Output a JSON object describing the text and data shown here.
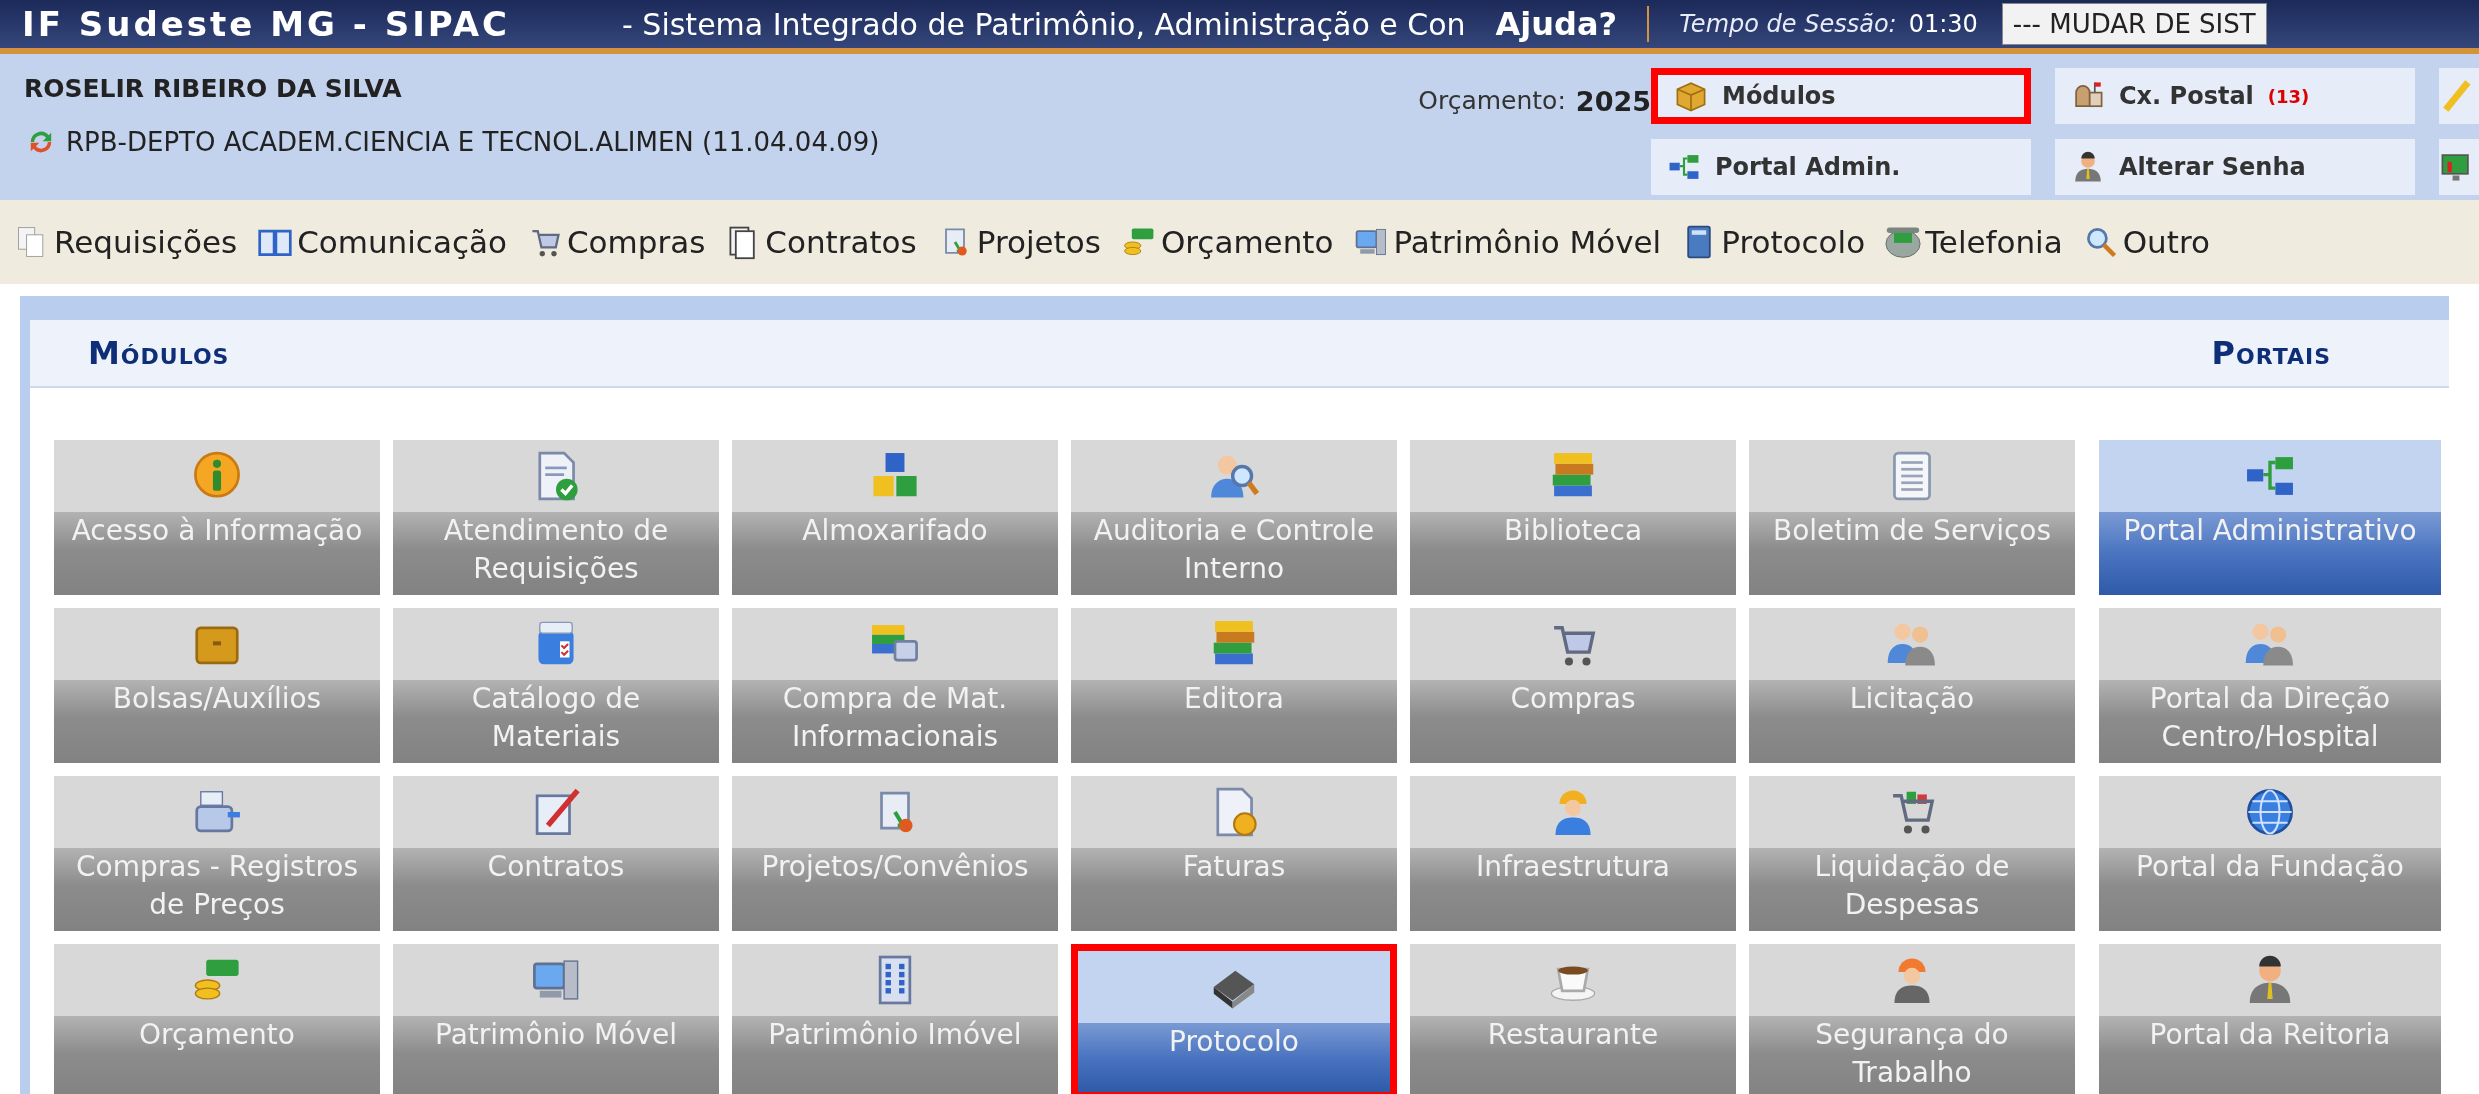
{
  "header": {
    "system": "IF Sudeste MG - SIPAC",
    "title": "- Sistema Integrado de Patrimônio, Administração e Con",
    "help": "Ajuda?",
    "session_label": "Tempo de Sessão:",
    "session_time": "01:30",
    "system_select": "--- MUDAR DE SIST"
  },
  "user": {
    "name": "ROSELIR RIBEIRO DA SILVA",
    "unit": "RPB-DEPTO ACADEM.CIENCIA E TECNOL.ALIMEN (11.04.04.09)"
  },
  "budget": {
    "label": "Orçamento:",
    "year": "2025"
  },
  "shortcuts": [
    {
      "label": "Módulos",
      "highlighted": true
    },
    {
      "label": "Cx. Postal",
      "badge": "(13)",
      "highlighted": false
    },
    {
      "label": "Portal Admin.",
      "highlighted": false
    },
    {
      "label": "Alterar Senha",
      "highlighted": false
    }
  ],
  "menu": [
    "Requisições",
    "Comunicação",
    "Compras",
    "Contratos",
    "Projetos",
    "Orçamento",
    "Patrimônio Móvel",
    "Protocolo",
    "Telefonia",
    "Outro"
  ],
  "modules": {
    "title": "Módulos",
    "items": [
      {
        "label": "Acesso à Informação",
        "selected": false,
        "highlighted": false
      },
      {
        "label": "Atendimento de Requisições",
        "selected": false,
        "highlighted": false
      },
      {
        "label": "Almoxarifado",
        "selected": false,
        "highlighted": false
      },
      {
        "label": "Auditoria e Controle Interno",
        "selected": false,
        "highlighted": false
      },
      {
        "label": "Biblioteca",
        "selected": false,
        "highlighted": false
      },
      {
        "label": "Boletim de Serviços",
        "selected": false,
        "highlighted": false
      },
      {
        "label": "Bolsas/Auxílios",
        "selected": false,
        "highlighted": false
      },
      {
        "label": "Catálogo de Materiais",
        "selected": false,
        "highlighted": false
      },
      {
        "label": "Compra de Mat. Informacionais",
        "selected": false,
        "highlighted": false
      },
      {
        "label": "Editora",
        "selected": false,
        "highlighted": false
      },
      {
        "label": "Compras",
        "selected": false,
        "highlighted": false
      },
      {
        "label": "Licitação",
        "selected": false,
        "highlighted": false
      },
      {
        "label": "Compras - Registros de Preços",
        "selected": false,
        "highlighted": false
      },
      {
        "label": "Contratos",
        "selected": false,
        "highlighted": false
      },
      {
        "label": "Projetos/Convênios",
        "selected": false,
        "highlighted": false
      },
      {
        "label": "Faturas",
        "selected": false,
        "highlighted": false
      },
      {
        "label": "Infraestrutura",
        "selected": false,
        "highlighted": false
      },
      {
        "label": "Liquidação de Despesas",
        "selected": false,
        "highlighted": false
      },
      {
        "label": "Orçamento",
        "selected": false,
        "highlighted": false
      },
      {
        "label": "Patrimônio Móvel",
        "selected": false,
        "highlighted": false
      },
      {
        "label": "Patrimônio Imóvel",
        "selected": false,
        "highlighted": false
      },
      {
        "label": "Protocolo",
        "selected": true,
        "highlighted": true
      },
      {
        "label": "Restaurante",
        "selected": false,
        "highlighted": false
      },
      {
        "label": "Segurança do Trabalho",
        "selected": false,
        "highlighted": false
      }
    ]
  },
  "portals": {
    "title": "Portais",
    "items": [
      {
        "label": "Portal Administrativo",
        "selected": true,
        "highlighted": false
      },
      {
        "label": "Portal da Direção Centro/Hospital",
        "selected": false,
        "highlighted": false
      },
      {
        "label": "Portal da Fundação",
        "selected": false,
        "highlighted": false
      },
      {
        "label": "Portal da Reitoria",
        "selected": false,
        "highlighted": false
      }
    ]
  }
}
